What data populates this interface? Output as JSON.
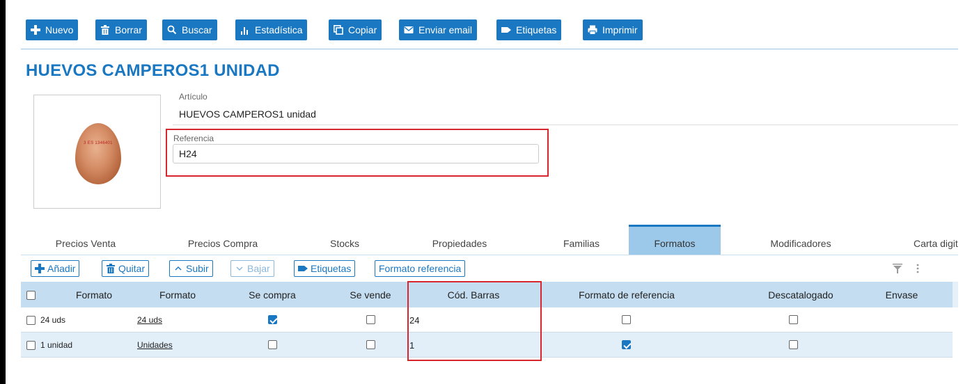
{
  "toolbar": {
    "nuevo": "Nuevo",
    "borrar": "Borrar",
    "buscar": "Buscar",
    "estadistica": "Estadística",
    "copiar": "Copiar",
    "enviar_email": "Enviar email",
    "etiquetas": "Etiquetas",
    "imprimir": "Imprimir",
    "color": "#1a78c2"
  },
  "page_title": "HUEVOS CAMPEROS1 UNIDAD",
  "article": {
    "label": "Artículo",
    "value": "HUEVOS CAMPEROS1 unidad"
  },
  "reference": {
    "label": "Referencia",
    "value": "H24"
  },
  "egg_stamp": "3 ES 1346401",
  "tabs": [
    {
      "label": "Precios Venta"
    },
    {
      "label": "Precios Compra"
    },
    {
      "label": "Stocks"
    },
    {
      "label": "Propiedades"
    },
    {
      "label": "Familias"
    },
    {
      "label": "Formatos",
      "active": true
    },
    {
      "label": "Modificadores"
    },
    {
      "label": "Carta digit"
    }
  ],
  "sub_toolbar": {
    "anadir": "Añadir",
    "quitar": "Quitar",
    "subir": "Subir",
    "bajar": "Bajar",
    "etiquetas": "Etiquetas",
    "formato_referencia": "Formato referencia"
  },
  "table": {
    "columns": [
      "Formato",
      "Formato",
      "Se compra",
      "Se vende",
      "Cód. Barras",
      "Formato de referencia",
      "Descatalogado",
      "Envase"
    ],
    "rows": [
      {
        "selected": false,
        "formato": "24 uds",
        "formato_link": "24 uds",
        "se_compra": true,
        "se_vende": false,
        "cod_barras": "24",
        "formato_ref": false,
        "descatalogado": false
      },
      {
        "selected": false,
        "formato": "1 unidad",
        "formato_link": "Unidades",
        "se_compra": false,
        "se_vende": false,
        "cod_barras": "1",
        "formato_ref": true,
        "descatalogado": false
      }
    ]
  },
  "highlight_color": "#d7262e"
}
